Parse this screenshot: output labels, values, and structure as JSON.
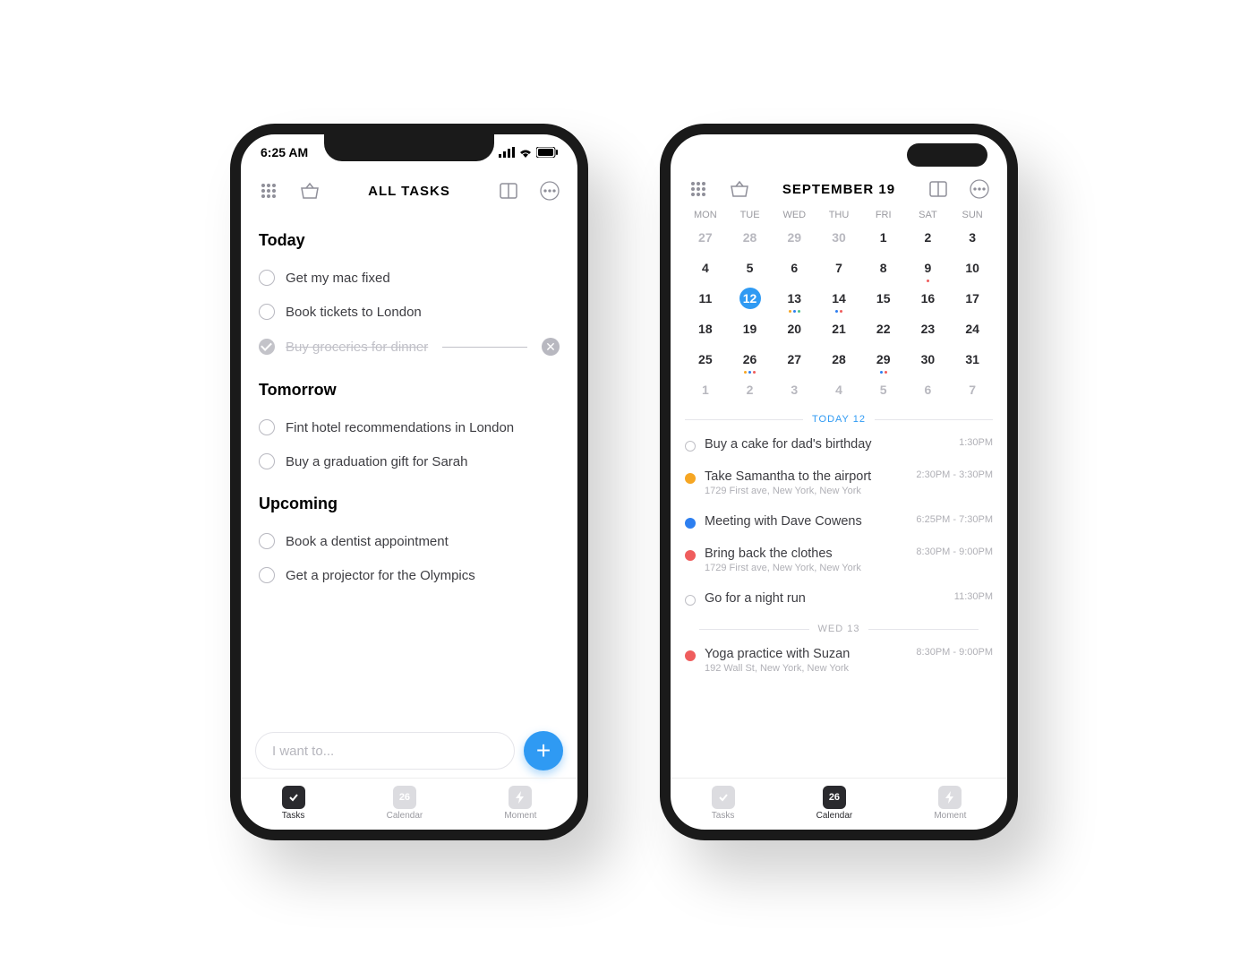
{
  "colors": {
    "accent": "#2f9af3",
    "orange": "#f6a623",
    "blue": "#2d7ff0",
    "red": "#ef5d5d",
    "green": "#4cc08b"
  },
  "phone1": {
    "status_time": "6:25 AM",
    "toolbar_title": "ALL TASKS",
    "sections": [
      {
        "title": "Today",
        "tasks": [
          {
            "text": "Get my mac fixed",
            "done": false
          },
          {
            "text": "Book tickets to London",
            "done": false
          },
          {
            "text": "Buy groceries for dinner",
            "done": true
          }
        ]
      },
      {
        "title": "Tomorrow",
        "tasks": [
          {
            "text": "Fint hotel recommendations in London",
            "done": false
          },
          {
            "text": "Buy a graduation gift for Sarah",
            "done": false
          }
        ]
      },
      {
        "title": "Upcoming",
        "tasks": [
          {
            "text": "Book a dentist appointment",
            "done": false
          },
          {
            "text": "Get a projector for the Olympics",
            "done": false
          }
        ]
      }
    ],
    "input_placeholder": "I want to...",
    "tabs": [
      {
        "label": "Tasks",
        "value": "",
        "active": true,
        "kind": "check"
      },
      {
        "label": "Calendar",
        "value": "26",
        "active": false,
        "kind": "date"
      },
      {
        "label": "Moment",
        "value": "",
        "active": false,
        "kind": "bolt"
      }
    ]
  },
  "phone2": {
    "toolbar_title": "SEPTEMBER 19",
    "weekdays": [
      "MON",
      "TUE",
      "WED",
      "THU",
      "FRI",
      "SAT",
      "SUN"
    ],
    "calendar": [
      [
        {
          "n": "27",
          "m": 1
        },
        {
          "n": "28",
          "m": 1
        },
        {
          "n": "29",
          "m": 1
        },
        {
          "n": "30",
          "m": 1
        },
        {
          "n": "1"
        },
        {
          "n": "2"
        },
        {
          "n": "3"
        }
      ],
      [
        {
          "n": "4"
        },
        {
          "n": "5"
        },
        {
          "n": "6"
        },
        {
          "n": "7"
        },
        {
          "n": "8"
        },
        {
          "n": "9",
          "dots": [
            "#ef5d5d"
          ]
        },
        {
          "n": "10"
        }
      ],
      [
        {
          "n": "11"
        },
        {
          "n": "12",
          "sel": 1
        },
        {
          "n": "13",
          "dots": [
            "#f6a623",
            "#2d7ff0",
            "#4cc08b"
          ]
        },
        {
          "n": "14",
          "dots": [
            "#2d7ff0",
            "#ef5d5d"
          ]
        },
        {
          "n": "15"
        },
        {
          "n": "16"
        },
        {
          "n": "17"
        }
      ],
      [
        {
          "n": "18"
        },
        {
          "n": "19"
        },
        {
          "n": "20"
        },
        {
          "n": "21"
        },
        {
          "n": "22"
        },
        {
          "n": "23"
        },
        {
          "n": "24"
        }
      ],
      [
        {
          "n": "25"
        },
        {
          "n": "26",
          "dots": [
            "#f6a623",
            "#2d7ff0",
            "#ef5d5d"
          ]
        },
        {
          "n": "27"
        },
        {
          "n": "28"
        },
        {
          "n": "29",
          "dots": [
            "#2d7ff0",
            "#ef5d5d"
          ]
        },
        {
          "n": "30"
        },
        {
          "n": "31"
        }
      ],
      [
        {
          "n": "1",
          "m": 1
        },
        {
          "n": "2",
          "m": 1
        },
        {
          "n": "3",
          "m": 1
        },
        {
          "n": "4",
          "m": 1
        },
        {
          "n": "5",
          "m": 1
        },
        {
          "n": "6",
          "m": 1
        },
        {
          "n": "7",
          "m": 1
        }
      ]
    ],
    "today_label": "TODAY 12",
    "events_today": [
      {
        "dot": "outline",
        "title": "Buy a cake for dad's birthday",
        "sub": "",
        "time": "1:30PM"
      },
      {
        "dot": "#f6a623",
        "title": "Take Samantha to the airport",
        "sub": "1729 First ave, New York, New York",
        "time": "2:30PM - 3:30PM"
      },
      {
        "dot": "#2d7ff0",
        "title": "Meeting with Dave Cowens",
        "sub": "",
        "time": "6:25PM - 7:30PM"
      },
      {
        "dot": "#ef5d5d",
        "title": "Bring back the clothes",
        "sub": "1729 First ave, New York, New York",
        "time": "8:30PM - 9:00PM"
      },
      {
        "dot": "outline",
        "title": "Go for a night run",
        "sub": "",
        "time": "11:30PM"
      }
    ],
    "wed_label": "WED 13",
    "events_wed": [
      {
        "dot": "#ef5d5d",
        "title": "Yoga practice with Suzan",
        "sub": "192 Wall St, New York, New York",
        "time": "8:30PM - 9:00PM"
      }
    ],
    "tabs": [
      {
        "label": "Tasks",
        "value": "",
        "active": false,
        "kind": "check"
      },
      {
        "label": "Calendar",
        "value": "26",
        "active": true,
        "kind": "date"
      },
      {
        "label": "Moment",
        "value": "",
        "active": false,
        "kind": "bolt"
      }
    ]
  }
}
